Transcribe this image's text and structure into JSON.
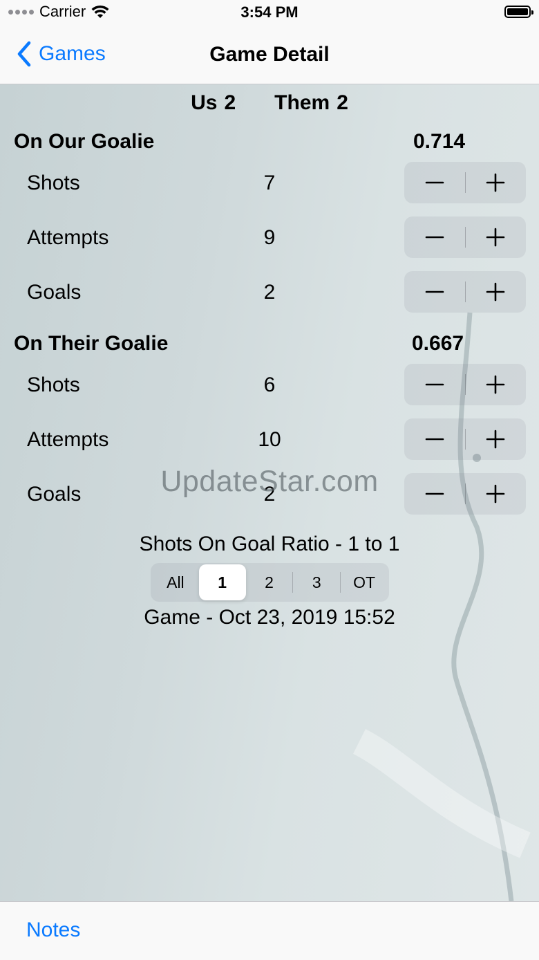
{
  "status_bar": {
    "carrier": "Carrier",
    "time": "3:54 PM"
  },
  "nav": {
    "back_label": "Games",
    "title": "Game Detail"
  },
  "score": {
    "us_label": "Us",
    "us_value": "2",
    "them_label": "Them",
    "them_value": "2"
  },
  "our_goalie": {
    "title": "On Our Goalie",
    "percentage": "0.714",
    "rows": [
      {
        "label": "Shots",
        "value": "7"
      },
      {
        "label": "Attempts",
        "value": "9"
      },
      {
        "label": "Goals",
        "value": "2"
      }
    ]
  },
  "their_goalie": {
    "title": "On Their Goalie",
    "percentage": "0.667",
    "rows": [
      {
        "label": "Shots",
        "value": "6"
      },
      {
        "label": "Attempts",
        "value": "10"
      },
      {
        "label": "Goals",
        "value": "2"
      }
    ]
  },
  "ratio": "Shots On Goal Ratio -  1 to  1",
  "periods": {
    "options": [
      "All",
      "1",
      "2",
      "3",
      "OT"
    ],
    "selected": "1"
  },
  "game_date": "Game - Oct 23, 2019 15:52",
  "watermark": "UpdateStar.com",
  "toolbar": {
    "notes_label": "Notes"
  },
  "icons": {
    "minus": "minus-icon",
    "plus": "plus-icon",
    "back": "chevron-left-icon",
    "wifi": "wifi-icon",
    "battery": "battery-icon"
  },
  "colors": {
    "tint": "#0a7aff"
  }
}
